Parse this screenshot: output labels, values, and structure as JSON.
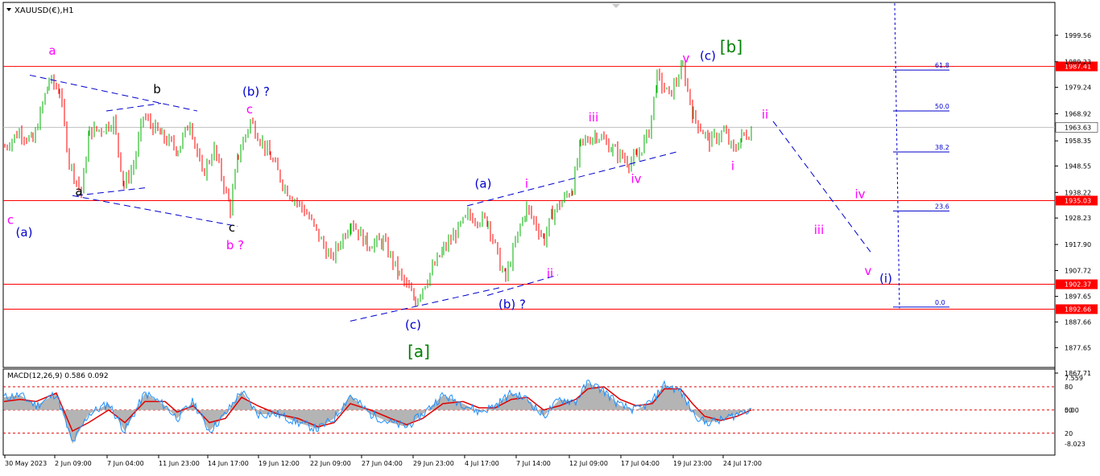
{
  "window": {
    "symbol_label": "XAUUSD(€),H1",
    "menu_icon": "triangle-down-icon"
  },
  "colors": {
    "background": "#ffffff",
    "bull": "#00b000",
    "bear": "#ff0000",
    "level_line": "#ff0000",
    "wave_blue": "#0000cc",
    "wave_magenta": "#ff00ff",
    "wave_black": "#000000",
    "wave_green": "#008000",
    "trendline": "#0000cc",
    "macd_hist": "#b4b4b4",
    "macd_signal": "#e00000",
    "macd_main": "#1e90ff"
  },
  "chart_data": [
    {
      "type": "candlestick",
      "title": "XAUUSD(€),H1",
      "ylim": [
        1867.71,
        2009.56
      ],
      "y_ticks": [
        "1999.56",
        "1989.23",
        "1979.24",
        "1968.92",
        "1958.35",
        "1948.55",
        "1938.22",
        "1928.23",
        "1917.90",
        "1907.72",
        "1897.65",
        "1887.66",
        "1877.65",
        "1867.71"
      ],
      "x_tick_labels": [
        "30 May 2023",
        "2 Jun 09:00",
        "7 Jun 04:00",
        "11 Jun 23:00",
        "14 Jun 17:00",
        "19 Jun 12:00",
        "22 Jun 09:00",
        "27 Jun 04:00",
        "29 Jun 23:00",
        "4 Jul 17:00",
        "7 Jul 14:00",
        "12 Jul 09:00",
        "17 Jul 04:00",
        "19 Jul 23:00",
        "24 Jul 17:00"
      ],
      "grid": false,
      "price_path": [
        {
          "t": 0,
          "p": 1956
        },
        {
          "t": 18,
          "p": 1962
        },
        {
          "t": 35,
          "p": 1958
        },
        {
          "t": 55,
          "p": 1982
        },
        {
          "t": 68,
          "p": 1978
        },
        {
          "t": 80,
          "p": 1950
        },
        {
          "t": 95,
          "p": 1938
        },
        {
          "t": 105,
          "p": 1962
        },
        {
          "t": 120,
          "p": 1963
        },
        {
          "t": 135,
          "p": 1966
        },
        {
          "t": 148,
          "p": 1941
        },
        {
          "t": 160,
          "p": 1949
        },
        {
          "t": 172,
          "p": 1968
        },
        {
          "t": 195,
          "p": 1960
        },
        {
          "t": 215,
          "p": 1955
        },
        {
          "t": 230,
          "p": 1966
        },
        {
          "t": 245,
          "p": 1945
        },
        {
          "t": 260,
          "p": 1955
        },
        {
          "t": 280,
          "p": 1932
        },
        {
          "t": 290,
          "p": 1953
        },
        {
          "t": 305,
          "p": 1966
        },
        {
          "t": 330,
          "p": 1952
        },
        {
          "t": 348,
          "p": 1940
        },
        {
          "t": 375,
          "p": 1930
        },
        {
          "t": 405,
          "p": 1912
        },
        {
          "t": 430,
          "p": 1927
        },
        {
          "t": 450,
          "p": 1918
        },
        {
          "t": 470,
          "p": 1919
        },
        {
          "t": 490,
          "p": 1906
        },
        {
          "t": 510,
          "p": 1896
        },
        {
          "t": 525,
          "p": 1905
        },
        {
          "t": 545,
          "p": 1916
        },
        {
          "t": 575,
          "p": 1929
        },
        {
          "t": 600,
          "p": 1927
        },
        {
          "t": 615,
          "p": 1910
        },
        {
          "t": 622,
          "p": 1905
        },
        {
          "t": 640,
          "p": 1925
        },
        {
          "t": 648,
          "p": 1932
        },
        {
          "t": 670,
          "p": 1920
        },
        {
          "t": 680,
          "p": 1930
        },
        {
          "t": 705,
          "p": 1940
        },
        {
          "t": 715,
          "p": 1957
        },
        {
          "t": 735,
          "p": 1961
        },
        {
          "t": 755,
          "p": 1955
        },
        {
          "t": 775,
          "p": 1950
        },
        {
          "t": 785,
          "p": 1952
        },
        {
          "t": 800,
          "p": 1962
        },
        {
          "t": 810,
          "p": 1983
        },
        {
          "t": 825,
          "p": 1976
        },
        {
          "t": 842,
          "p": 1987
        },
        {
          "t": 855,
          "p": 1968
        },
        {
          "t": 875,
          "p": 1958
        },
        {
          "t": 893,
          "p": 1962
        },
        {
          "t": 905,
          "p": 1954
        },
        {
          "t": 915,
          "p": 1960
        },
        {
          "t": 928,
          "p": 1962
        }
      ],
      "last_price": "1963.63",
      "horizontal_levels": [
        "1987.41",
        "1935.03",
        "1902.37",
        "1892.66"
      ],
      "fibonacci_levels": [
        {
          "label": "61.8",
          "price": 1986.0
        },
        {
          "label": "50.0",
          "price": 1970.0
        },
        {
          "label": "38.2",
          "price": 1954.0
        },
        {
          "label": "23.6",
          "price": 1931.0
        },
        {
          "label": "0.0",
          "price": 1893.5
        }
      ],
      "wave_labels": [
        {
          "text": "a",
          "color": "magenta",
          "t": 60,
          "p": 1992
        },
        {
          "text": "b",
          "color": "black",
          "t": 190,
          "p": 1977
        },
        {
          "text": "a",
          "color": "black",
          "t": 93,
          "p": 1937
        },
        {
          "text": "c",
          "color": "black",
          "t": 283,
          "p": 1923
        },
        {
          "text": "c",
          "color": "magenta",
          "t": 8,
          "p": 1926
        },
        {
          "text": "(a)",
          "color": "blue",
          "t": 25,
          "p": 1921
        },
        {
          "text": "(b) ?",
          "color": "blue",
          "t": 313,
          "p": 1976
        },
        {
          "text": "c",
          "color": "magenta",
          "t": 305,
          "p": 1969
        },
        {
          "text": "b ?",
          "color": "magenta",
          "t": 287,
          "p": 1916
        },
        {
          "text": "(c)",
          "color": "blue",
          "t": 508,
          "p": 1885
        },
        {
          "text": "[a]",
          "color": "green",
          "t": 515,
          "p": 1874
        },
        {
          "text": "(a)",
          "color": "blue",
          "t": 595,
          "p": 1940
        },
        {
          "text": "i",
          "color": "magenta",
          "t": 649,
          "p": 1940
        },
        {
          "text": "ii",
          "color": "magenta",
          "t": 678,
          "p": 1905
        },
        {
          "text": "(b) ?",
          "color": "blue",
          "t": 631,
          "p": 1893
        },
        {
          "text": "iii",
          "color": "magenta",
          "t": 732,
          "p": 1966
        },
        {
          "text": "iv",
          "color": "magenta",
          "t": 785,
          "p": 1942
        },
        {
          "text": "v",
          "color": "magenta",
          "t": 847,
          "p": 1989
        },
        {
          "text": "(c)",
          "color": "blue",
          "t": 874,
          "p": 1990
        },
        {
          "text": "[b]",
          "color": "green",
          "t": 903,
          "p": 1993
        },
        {
          "text": "ii",
          "color": "magenta",
          "t": 945,
          "p": 1967
        },
        {
          "text": "i",
          "color": "magenta",
          "t": 905,
          "p": 1947
        },
        {
          "text": "iv",
          "color": "magenta",
          "t": 1063,
          "p": 1936
        },
        {
          "text": "iii",
          "color": "magenta",
          "t": 1012,
          "p": 1922
        },
        {
          "text": "v",
          "color": "magenta",
          "t": 1073,
          "p": 1906
        },
        {
          "text": "(i)",
          "color": "blue",
          "t": 1095,
          "p": 1903
        }
      ],
      "trendlines": [
        {
          "t1": 32,
          "p1": 1984,
          "t2": 240,
          "p2": 1970
        },
        {
          "t1": 85,
          "p1": 1937,
          "t2": 290,
          "p2": 1925
        },
        {
          "t1": 90,
          "p1": 1937,
          "t2": 175,
          "p2": 1940
        },
        {
          "t1": 127,
          "p1": 1970,
          "t2": 195,
          "p2": 1973
        },
        {
          "t1": 430,
          "p1": 1888,
          "t2": 615,
          "p2": 1901
        },
        {
          "t1": 575,
          "p1": 1933,
          "t2": 835,
          "p2": 1954
        },
        {
          "t1": 600,
          "p1": 1898,
          "t2": 688,
          "p2": 1906
        },
        {
          "t1": 955,
          "p1": 1966,
          "t2": 1076,
          "p2": 1915
        }
      ],
      "projection_divider": {
        "t": 1106
      }
    },
    {
      "type": "line",
      "title": "MACD(12,26,9) 0.586 0.092",
      "ylim": [
        -10.5,
        9.5
      ],
      "y_ticks": [
        "7.559",
        "0.00",
        "-8.023"
      ],
      "inner_tick_labels": [
        "80",
        "50",
        "20"
      ],
      "series": [
        {
          "name": "MACD",
          "kind": "histogram",
          "x": [
            0,
            20,
            40,
            65,
            85,
            105,
            130,
            150,
            175,
            200,
            215,
            235,
            255,
            275,
            295,
            315,
            340,
            365,
            390,
            410,
            430,
            455,
            480,
            500,
            520,
            545,
            570,
            590,
            610,
            630,
            650,
            670,
            690,
            710,
            725,
            745,
            765,
            785,
            805,
            820,
            840,
            855,
            870,
            890,
            910,
            928
          ],
          "values": [
            3,
            3.5,
            1,
            4,
            -8,
            -1,
            1.5,
            -5,
            4,
            1,
            -2,
            2,
            -5,
            -1,
            4.5,
            -1,
            -1,
            -3,
            -4.5,
            -2,
            3.5,
            -1,
            -3,
            -4,
            -1,
            3.5,
            1.5,
            -0.5,
            1,
            4,
            2.5,
            -1.5,
            2.5,
            2,
            6.5,
            4.5,
            1,
            0,
            2,
            6,
            4.5,
            -0.5,
            -3,
            -2.5,
            -1,
            0.5
          ]
        },
        {
          "name": "Signal",
          "kind": "line",
          "x": [
            0,
            20,
            40,
            65,
            85,
            105,
            130,
            150,
            175,
            200,
            215,
            235,
            255,
            275,
            295,
            315,
            340,
            365,
            390,
            410,
            430,
            455,
            480,
            500,
            520,
            545,
            570,
            590,
            610,
            630,
            650,
            670,
            690,
            710,
            725,
            745,
            765,
            785,
            805,
            820,
            840,
            855,
            870,
            890,
            910,
            928
          ],
          "values": [
            2,
            2.5,
            2,
            4,
            -5,
            -3,
            0,
            -3,
            2,
            2,
            -0.5,
            1,
            -3,
            -2,
            3,
            1,
            -1,
            -2,
            -4,
            -3,
            1.5,
            0,
            -2,
            -3.5,
            -2,
            1.5,
            2,
            0.5,
            0.5,
            2.5,
            3,
            0,
            1,
            2.5,
            5,
            5.5,
            2.5,
            1,
            1.5,
            5,
            5,
            1.5,
            -1.5,
            -2.5,
            -1.5,
            0
          ]
        }
      ]
    }
  ]
}
